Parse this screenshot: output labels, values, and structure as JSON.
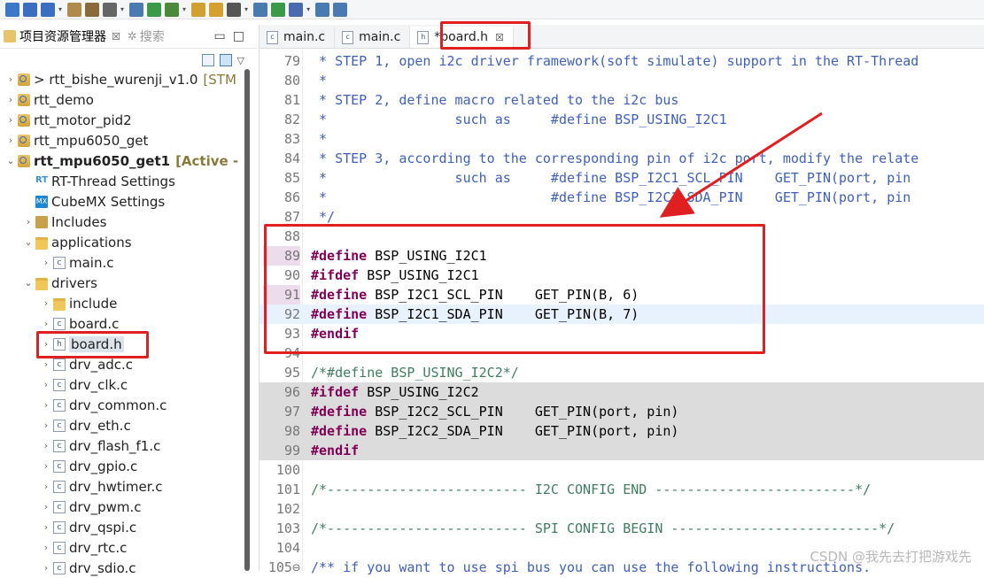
{
  "toolbar": {
    "icons": [
      "new-icon",
      "save-icon",
      "save-all-icon",
      "build-icon",
      "hammer-icon",
      "tools-icon",
      "monitor-icon",
      "gear-icon",
      "bug-icon",
      "run-icon",
      "open-icon",
      "search-icon",
      "book-icon",
      "download-icon",
      "layers-icon",
      "back-icon",
      "forward-icon"
    ]
  },
  "left_panel": {
    "tab_label": "项目资源管理器",
    "tab_close": "☒",
    "search_tab": "搜索",
    "tree": [
      {
        "label": "> rtt_bishe_wurenji_v1.0",
        "suffix": "[STM",
        "icon": "project-icon",
        "indent": 0,
        "twisty": "›"
      },
      {
        "label": "rtt_demo",
        "suffix": "",
        "icon": "project-icon",
        "indent": 0,
        "twisty": "›"
      },
      {
        "label": "rtt_motor_pid2",
        "suffix": "",
        "icon": "project-icon",
        "indent": 0,
        "twisty": "›"
      },
      {
        "label": "rtt_mpu6050_get",
        "suffix": "",
        "icon": "project-icon",
        "indent": 0,
        "twisty": "›"
      },
      {
        "label": "rtt_mpu6050_get1",
        "suffix": "[Active -",
        "icon": "project-icon",
        "indent": 0,
        "twisty": "⌄",
        "bold": true
      },
      {
        "label": "RT-Thread Settings",
        "suffix": "",
        "icon": "rtthread-icon",
        "indent": 1,
        "twisty": ""
      },
      {
        "label": "CubeMX Settings",
        "suffix": "",
        "icon": "cubemx-icon",
        "indent": 1,
        "twisty": ""
      },
      {
        "label": "Includes",
        "suffix": "",
        "icon": "includes-icon",
        "indent": 1,
        "twisty": "›"
      },
      {
        "label": "applications",
        "suffix": "",
        "icon": "folder-icon",
        "indent": 1,
        "twisty": "⌄"
      },
      {
        "label": "main.c",
        "suffix": "",
        "icon": "c-file-icon",
        "indent": 2,
        "twisty": "›"
      },
      {
        "label": "drivers",
        "suffix": "",
        "icon": "folder-icon",
        "indent": 1,
        "twisty": "⌄"
      },
      {
        "label": "include",
        "suffix": "",
        "icon": "folder-icon",
        "indent": 2,
        "twisty": "›"
      },
      {
        "label": "board.c",
        "suffix": "",
        "icon": "c-file-icon",
        "indent": 2,
        "twisty": "›"
      },
      {
        "label": "board.h",
        "suffix": "",
        "icon": "h-file-icon",
        "indent": 2,
        "twisty": "›",
        "highlight": true
      },
      {
        "label": "drv_adc.c",
        "suffix": "",
        "icon": "c-file-icon",
        "indent": 2,
        "twisty": "›"
      },
      {
        "label": "drv_clk.c",
        "suffix": "",
        "icon": "c-file-icon",
        "indent": 2,
        "twisty": "›"
      },
      {
        "label": "drv_common.c",
        "suffix": "",
        "icon": "c-file-icon",
        "indent": 2,
        "twisty": "›"
      },
      {
        "label": "drv_eth.c",
        "suffix": "",
        "icon": "c-file-icon",
        "indent": 2,
        "twisty": "›"
      },
      {
        "label": "drv_flash_f1.c",
        "suffix": "",
        "icon": "c-file-icon",
        "indent": 2,
        "twisty": "›"
      },
      {
        "label": "drv_gpio.c",
        "suffix": "",
        "icon": "c-file-icon",
        "indent": 2,
        "twisty": "›"
      },
      {
        "label": "drv_hwtimer.c",
        "suffix": "",
        "icon": "c-file-icon",
        "indent": 2,
        "twisty": "›"
      },
      {
        "label": "drv_pwm.c",
        "suffix": "",
        "icon": "c-file-icon",
        "indent": 2,
        "twisty": "›"
      },
      {
        "label": "drv_qspi.c",
        "suffix": "",
        "icon": "c-file-icon",
        "indent": 2,
        "twisty": "›"
      },
      {
        "label": "drv_rtc.c",
        "suffix": "",
        "icon": "c-file-icon",
        "indent": 2,
        "twisty": "›"
      },
      {
        "label": "drv_sdio.c",
        "suffix": "",
        "icon": "c-file-icon",
        "indent": 2,
        "twisty": "›"
      }
    ]
  },
  "editor": {
    "tabs": [
      {
        "label": "main.c",
        "active": false
      },
      {
        "label": "main.c",
        "active": false
      },
      {
        "label": "*board.h",
        "active": true,
        "close": "☒"
      }
    ],
    "lines": [
      {
        "n": "79",
        "parts": [
          {
            "t": " * STEP 1, open i2c driver framework(soft simulate) support in the RT-Thread",
            "c": "cmt-blue"
          }
        ]
      },
      {
        "n": "80",
        "parts": [
          {
            "t": " *",
            "c": "cmt-blue"
          }
        ]
      },
      {
        "n": "81",
        "parts": [
          {
            "t": " * STEP 2, define macro related to the i2c bus",
            "c": "cmt-blue"
          }
        ]
      },
      {
        "n": "82",
        "parts": [
          {
            "t": " *                such as     #define BSP_USING_I2C1",
            "c": "cmt-blue"
          }
        ]
      },
      {
        "n": "83",
        "parts": [
          {
            "t": " *",
            "c": "cmt-blue"
          }
        ]
      },
      {
        "n": "84",
        "parts": [
          {
            "t": " * STEP 3, according to the corresponding pin of i2c port, modify the relate",
            "c": "cmt-blue"
          }
        ]
      },
      {
        "n": "85",
        "parts": [
          {
            "t": " *                such as     #define BSP_I2C1_SCL_PIN    GET_PIN(port, pin",
            "c": "cmt-blue"
          }
        ]
      },
      {
        "n": "86",
        "parts": [
          {
            "t": " *                            #define BSP_I2C1_SDA_PIN    GET_PIN(port, pin",
            "c": "cmt-blue"
          }
        ]
      },
      {
        "n": "87",
        "parts": [
          {
            "t": " */",
            "c": "cmt-blue"
          }
        ]
      },
      {
        "n": "88",
        "parts": []
      },
      {
        "n": "89",
        "style": "bk",
        "parts": [
          {
            "t": "#define",
            "c": "kw"
          },
          {
            "t": " BSP_USING_I2C1",
            "c": "plain"
          }
        ]
      },
      {
        "n": "90",
        "parts": [
          {
            "t": "#ifdef",
            "c": "kw"
          },
          {
            "t": " BSP_USING_I2C1",
            "c": "plain"
          }
        ]
      },
      {
        "n": "91",
        "style": "bk",
        "parts": [
          {
            "t": "#define",
            "c": "kw"
          },
          {
            "t": " BSP_I2C1_SCL_PIN    GET_PIN(B, 6)",
            "c": "plain"
          }
        ]
      },
      {
        "n": "92",
        "style": "cur",
        "parts": [
          {
            "t": "#define",
            "c": "kw"
          },
          {
            "t": " BSP_I2C1_SDA_PIN    GET_PIN(B, 7)",
            "c": "plain"
          }
        ]
      },
      {
        "n": "93",
        "parts": [
          {
            "t": "#endif",
            "c": "kw"
          }
        ]
      },
      {
        "n": "94",
        "parts": []
      },
      {
        "n": "95",
        "parts": [
          {
            "t": "/*#define BSP_USING_I2C2*/",
            "c": "cmt"
          }
        ]
      },
      {
        "n": "96",
        "style": "gray",
        "parts": [
          {
            "t": "#ifdef",
            "c": "kw"
          },
          {
            "t": " BSP_USING_I2C2",
            "c": "plain"
          }
        ]
      },
      {
        "n": "97",
        "style": "gray",
        "parts": [
          {
            "t": "#define",
            "c": "kw"
          },
          {
            "t": " BSP_I2C2_SCL_PIN    GET_PIN(port, pin)",
            "c": "plain"
          }
        ]
      },
      {
        "n": "98",
        "style": "gray",
        "parts": [
          {
            "t": "#define",
            "c": "kw"
          },
          {
            "t": " BSP_I2C2_SDA_PIN    GET_PIN(port, pin)",
            "c": "plain"
          }
        ]
      },
      {
        "n": "99",
        "style": "gray",
        "parts": [
          {
            "t": "#endif",
            "c": "kw"
          }
        ]
      },
      {
        "n": "100",
        "parts": []
      },
      {
        "n": "101",
        "parts": [
          {
            "t": "/*------------------------- I2C CONFIG END -------------------------*/",
            "c": "cmt"
          }
        ]
      },
      {
        "n": "102",
        "parts": []
      },
      {
        "n": "103",
        "parts": [
          {
            "t": "/*------------------------- SPI CONFIG BEGIN --------------------------*/",
            "c": "cmt"
          }
        ]
      },
      {
        "n": "104",
        "parts": []
      },
      {
        "n": "105⊖",
        "parts": [
          {
            "t": "/** if you want to use spi bus you can use the following instructions.",
            "c": "cmt-blue"
          }
        ]
      }
    ]
  },
  "watermark": "CSDN @我先去打把游戏先",
  "colors": {
    "highlight_red": "#e02020",
    "keyword": "#7f0055",
    "comment": "#3f7f5f"
  }
}
